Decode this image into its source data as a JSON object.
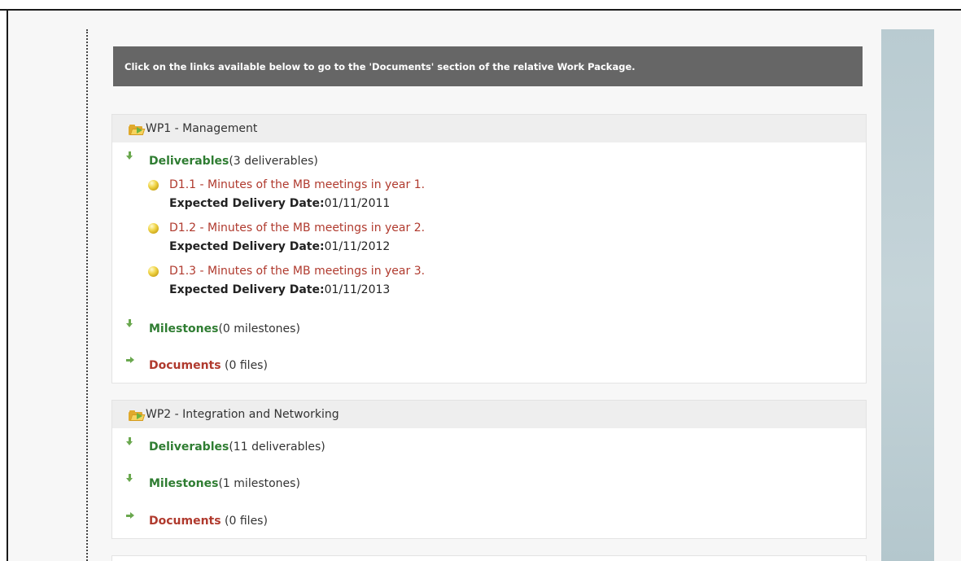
{
  "banner": {
    "text": "Click on the links available below to go to the 'Documents' section of the relative Work Package."
  },
  "work_packages": [
    {
      "title": "WP1 - Management",
      "deliverables": {
        "label": "Deliverables",
        "count": "(3 deliverables)"
      },
      "items": [
        {
          "title": "D1.1 - Minutes of the MB meetings in year 1.",
          "date_label": "Expected Delivery Date:",
          "date": "01/11/2011"
        },
        {
          "title": "D1.2 - Minutes of the MB meetings in year 2.",
          "date_label": "Expected Delivery Date:",
          "date": "01/11/2012"
        },
        {
          "title": "D1.3 - Minutes of the MB meetings in year 3.",
          "date_label": "Expected Delivery Date:",
          "date": "01/11/2013"
        }
      ],
      "milestones": {
        "label": "Milestones",
        "count": "(0 milestones)"
      },
      "documents": {
        "label": "Documents",
        "count": " (0 files)"
      }
    },
    {
      "title": "WP2 - Integration and Networking",
      "deliverables": {
        "label": "Deliverables",
        "count": "(11 deliverables)"
      },
      "milestones": {
        "label": "Milestones",
        "count": "(1 milestones)"
      },
      "documents": {
        "label": "Documents",
        "count": " (0 files)"
      }
    }
  ],
  "colors": {
    "banner_bg": "#666666",
    "green_link": "#2f7d32",
    "red_link": "#b03a2e",
    "rail": "#bfd0d5"
  }
}
